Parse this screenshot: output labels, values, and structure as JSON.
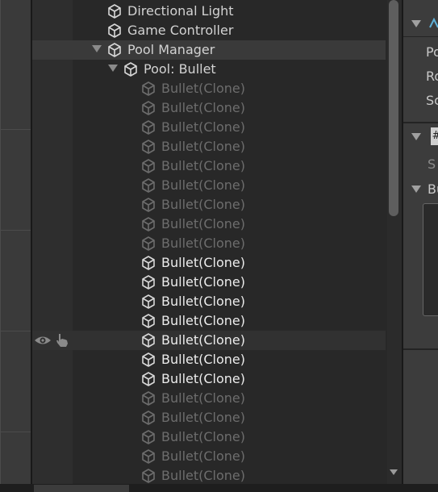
{
  "hierarchy": {
    "rows": [
      {
        "label": "Directional Light",
        "depth": 0,
        "style": "normal",
        "expander": false
      },
      {
        "label": "Game Controller",
        "depth": 0,
        "style": "normal",
        "expander": false
      },
      {
        "label": "Pool Manager",
        "depth": 0,
        "style": "normal",
        "expander": true,
        "selected": true
      },
      {
        "label": "Pool: Bullet",
        "depth": 1,
        "style": "normal",
        "expander": true
      },
      {
        "label": "Bullet(Clone)",
        "depth": 2,
        "style": "dim"
      },
      {
        "label": "Bullet(Clone)",
        "depth": 2,
        "style": "dim"
      },
      {
        "label": "Bullet(Clone)",
        "depth": 2,
        "style": "dim"
      },
      {
        "label": "Bullet(Clone)",
        "depth": 2,
        "style": "dim"
      },
      {
        "label": "Bullet(Clone)",
        "depth": 2,
        "style": "dim"
      },
      {
        "label": "Bullet(Clone)",
        "depth": 2,
        "style": "dim"
      },
      {
        "label": "Bullet(Clone)",
        "depth": 2,
        "style": "dim"
      },
      {
        "label": "Bullet(Clone)",
        "depth": 2,
        "style": "dim"
      },
      {
        "label": "Bullet(Clone)",
        "depth": 2,
        "style": "dim"
      },
      {
        "label": "Bullet(Clone)",
        "depth": 2,
        "style": "bright"
      },
      {
        "label": "Bullet(Clone)",
        "depth": 2,
        "style": "bright"
      },
      {
        "label": "Bullet(Clone)",
        "depth": 2,
        "style": "bright"
      },
      {
        "label": "Bullet(Clone)",
        "depth": 2,
        "style": "bright"
      },
      {
        "label": "Bullet(Clone)",
        "depth": 2,
        "style": "bright",
        "hover": true
      },
      {
        "label": "Bullet(Clone)",
        "depth": 2,
        "style": "bright"
      },
      {
        "label": "Bullet(Clone)",
        "depth": 2,
        "style": "bright"
      },
      {
        "label": "Bullet(Clone)",
        "depth": 2,
        "style": "dim"
      },
      {
        "label": "Bullet(Clone)",
        "depth": 2,
        "style": "dim"
      },
      {
        "label": "Bullet(Clone)",
        "depth": 2,
        "style": "dim"
      },
      {
        "label": "Bullet(Clone)",
        "depth": 2,
        "style": "dim"
      },
      {
        "label": "Bullet(Clone)",
        "depth": 2,
        "style": "dim"
      }
    ],
    "row_icon": "gameobject-cube-icon",
    "hover_icons": [
      "visibility-eye-icon",
      "pickable-hand-icon"
    ]
  },
  "inspector": {
    "labels": [
      "Po",
      "Ro",
      "Sc",
      "S",
      "Bu"
    ],
    "script_badge": "#"
  },
  "colors": {
    "panel_bg": "#282828",
    "text_normal": "#d2d2d2",
    "text_bright": "#ececec",
    "text_dim": "#6d6d6d",
    "selected_bg": "#3a3a3a"
  }
}
